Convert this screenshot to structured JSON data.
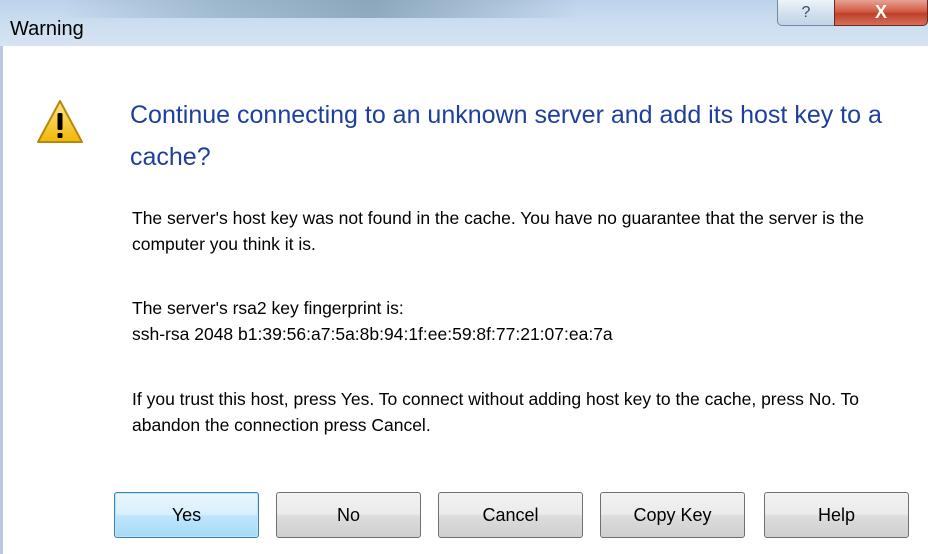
{
  "window": {
    "title": "Warning",
    "help_glyph": "?",
    "close_glyph": "X"
  },
  "icon": {
    "name": "warning-icon",
    "colors": {
      "fill": "#f5c518",
      "border": "#b8860b",
      "mark": "#000000"
    }
  },
  "content": {
    "main_instruction": "Continue connecting to an unknown server and add its host key to a cache?",
    "paragraph1": "The server's host key was not found in the cache. You have no guarantee that the server is the computer you think it is.",
    "fingerprint_label": "The server's rsa2 key fingerprint is:",
    "fingerprint_value": "ssh-rsa 2048 b1:39:56:a7:5a:8b:94:1f:ee:59:8f:77:21:07:ea:7a",
    "paragraph3": "If you trust this host, press Yes. To connect without adding host key to the cache, press No. To abandon the connection press Cancel."
  },
  "buttons": {
    "yes": "Yes",
    "no": "No",
    "cancel": "Cancel",
    "copy_key": "Copy Key",
    "help": "Help"
  },
  "colors": {
    "instruction_text": "#1f3f9e",
    "default_button_border": "#3c7fb1"
  }
}
